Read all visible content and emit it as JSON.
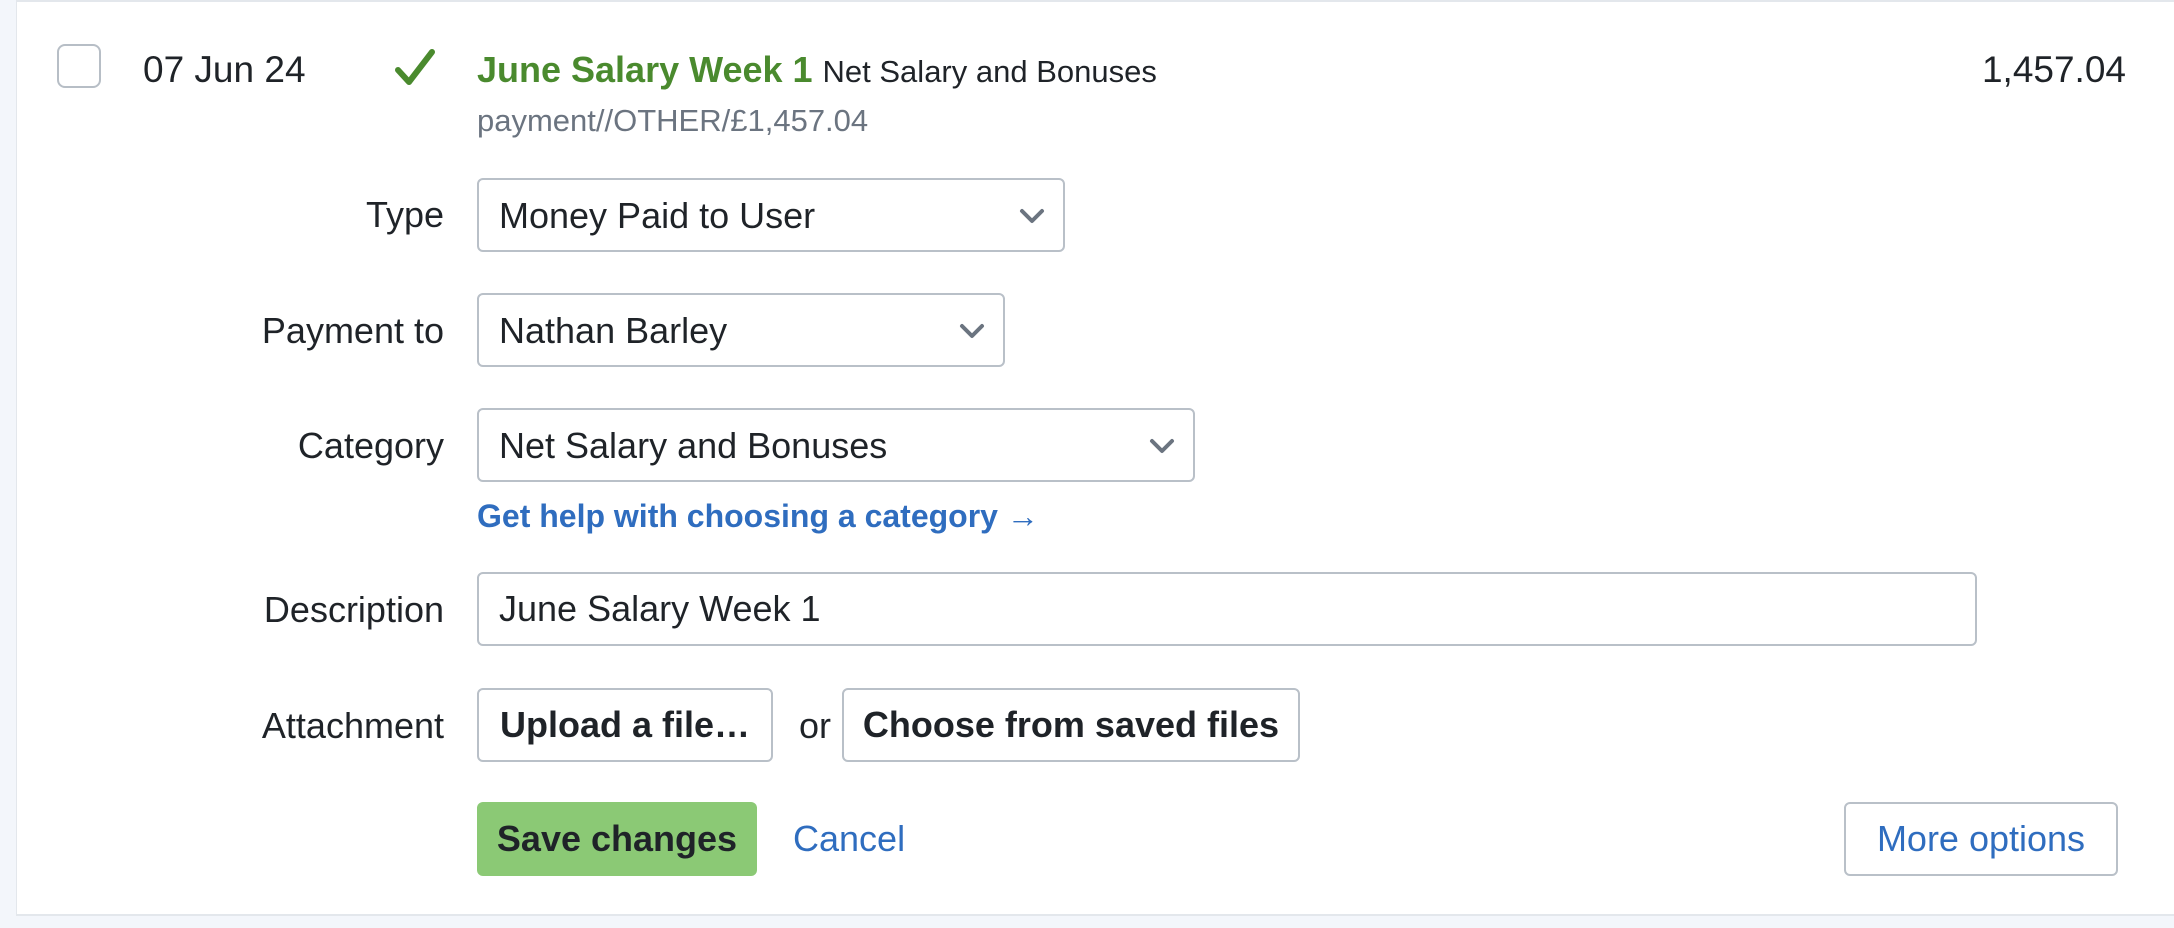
{
  "transaction": {
    "date": "07 Jun 24",
    "title": "June Salary Week 1",
    "category_inline": "Net Salary and Bonuses",
    "reference": "payment//OTHER/£1,457.04",
    "amount": "1,457.04",
    "status_icon": "checkmark-icon",
    "status_color": "#4a8a2e"
  },
  "form": {
    "type": {
      "label": "Type",
      "value": "Money Paid to User"
    },
    "payment_to": {
      "label": "Payment to",
      "value": "Nathan Barley"
    },
    "category": {
      "label": "Category",
      "value": "Net Salary and Bonuses",
      "help_link": "Get help with choosing a category →"
    },
    "description": {
      "label": "Description",
      "value": "June Salary Week 1"
    },
    "attachment": {
      "label": "Attachment",
      "upload_label": "Upload a file…",
      "or_text": "or",
      "choose_label": "Choose from saved files"
    }
  },
  "actions": {
    "save_label": "Save changes",
    "cancel_label": "Cancel",
    "more_label": "More options"
  },
  "colors": {
    "accent_green": "#8bc975",
    "link_blue": "#2f6dbf",
    "title_green": "#4a8a2e"
  }
}
